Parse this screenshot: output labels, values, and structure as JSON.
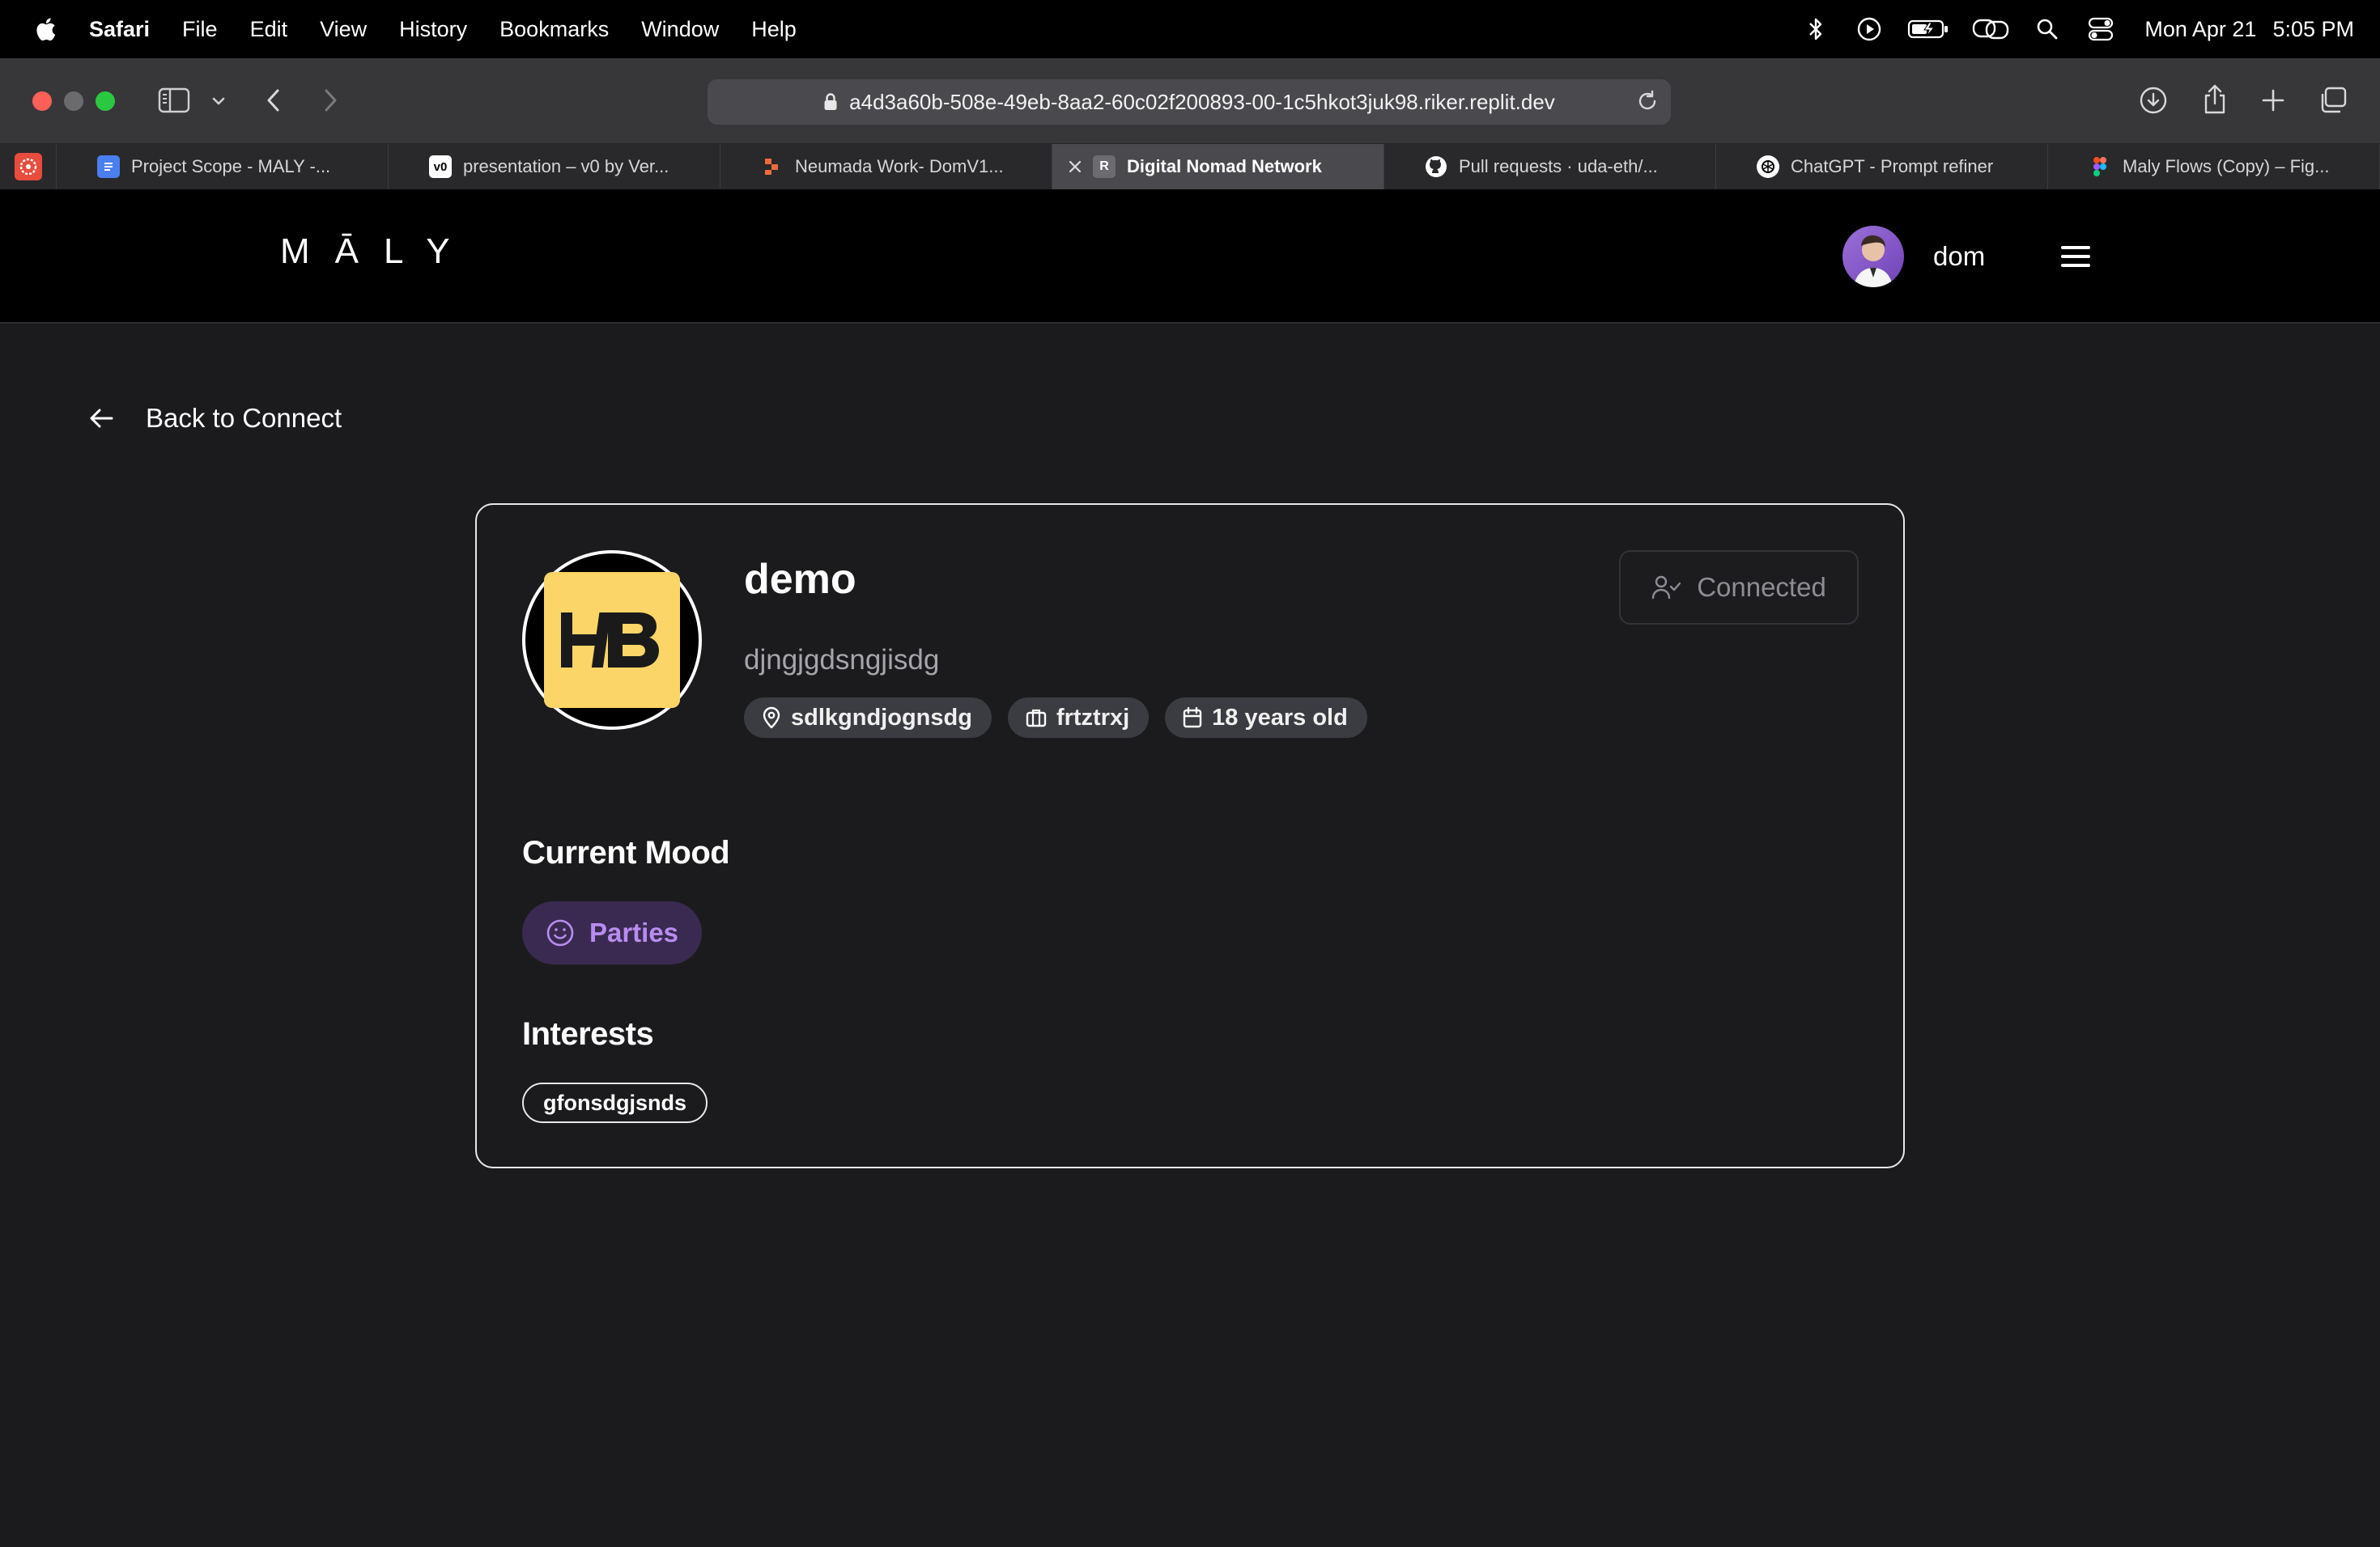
{
  "menubar": {
    "app": "Safari",
    "items": [
      "File",
      "Edit",
      "View",
      "History",
      "Bookmarks",
      "Window",
      "Help"
    ],
    "date": "Mon Apr 21",
    "time": "5:05 PM"
  },
  "browser": {
    "url": "a4d3a60b-508e-49eb-8aa2-60c02f200893-00-1c5hkot3juk98.riker.replit.dev",
    "tabs": [
      {
        "label": "Project Scope - MALY -...",
        "icon": "docs-icon",
        "color": "#4a7ff0"
      },
      {
        "label": "presentation – v0 by Ver...",
        "icon": "v0-icon",
        "color": "#ffffff"
      },
      {
        "label": "Neumada Work- DomV1...",
        "icon": "figma-like-icon",
        "color": "#f06a3c"
      },
      {
        "label": "Digital Nomad Network",
        "icon": "replit-icon",
        "color": "#6c6c70",
        "active": true
      },
      {
        "label": "Pull requests · uda-eth/...",
        "icon": "github-icon",
        "color": "#ffffff"
      },
      {
        "label": "ChatGPT - Prompt refiner",
        "icon": "chatgpt-icon",
        "color": "#ffffff"
      },
      {
        "label": "Maly Flows (Copy) – Fig...",
        "icon": "figma-icon",
        "color": "#f24e1e"
      }
    ]
  },
  "header": {
    "logo": "MĀLY",
    "user_name": "dom"
  },
  "page": {
    "back_label": "Back to Connect",
    "profile": {
      "name": "demo",
      "bio": "djngjgdsngjisdg",
      "location": "sdlkgndjognsdg",
      "occupation": "frtztrxj",
      "age": "18 years old",
      "connection_status": "Connected"
    },
    "mood": {
      "title": "Current Mood",
      "value": "Parties",
      "color": "#b98cf0"
    },
    "interests": {
      "title": "Interests",
      "items": [
        "gfonsdgjsnds"
      ]
    }
  }
}
